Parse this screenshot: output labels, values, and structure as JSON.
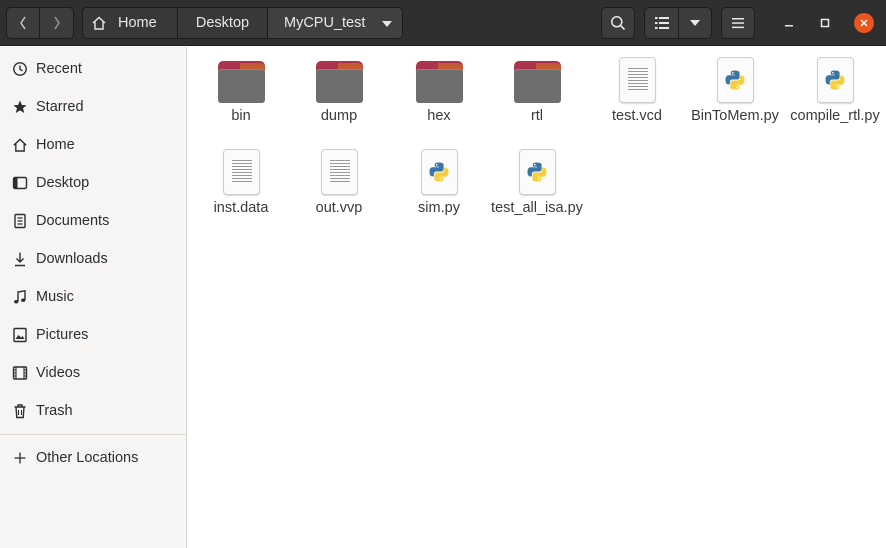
{
  "header": {
    "breadcrumbs": [
      "Home",
      "Desktop",
      "MyCPU_test"
    ],
    "close_color": "#e95420"
  },
  "sidebar": {
    "items": [
      {
        "label": "Recent",
        "icon": "clock-icon"
      },
      {
        "label": "Starred",
        "icon": "star-icon"
      },
      {
        "label": "Home",
        "icon": "home-icon"
      },
      {
        "label": "Desktop",
        "icon": "desktop-icon"
      },
      {
        "label": "Documents",
        "icon": "documents-icon"
      },
      {
        "label": "Downloads",
        "icon": "download-icon"
      },
      {
        "label": "Music",
        "icon": "music-icon"
      },
      {
        "label": "Pictures",
        "icon": "pictures-icon"
      },
      {
        "label": "Videos",
        "icon": "videos-icon"
      },
      {
        "label": "Trash",
        "icon": "trash-icon"
      }
    ],
    "other_locations": "Other Locations"
  },
  "files": [
    {
      "name": "bin",
      "type": "folder"
    },
    {
      "name": "dump",
      "type": "folder"
    },
    {
      "name": "hex",
      "type": "folder"
    },
    {
      "name": "rtl",
      "type": "folder"
    },
    {
      "name": "test.vcd",
      "type": "text"
    },
    {
      "name": "BinToMem.py",
      "type": "python"
    },
    {
      "name": "compile_rtl.py",
      "type": "python"
    },
    {
      "name": "inst.data",
      "type": "text"
    },
    {
      "name": "out.vvp",
      "type": "text"
    },
    {
      "name": "sim.py",
      "type": "python"
    },
    {
      "name": "test_all_isa.py",
      "type": "python"
    }
  ]
}
